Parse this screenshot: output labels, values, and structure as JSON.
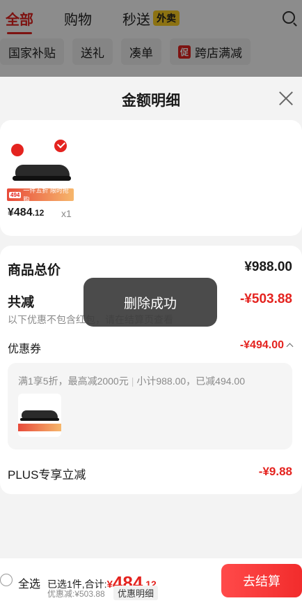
{
  "background": {
    "tabs": [
      {
        "label": "全部",
        "active": true
      },
      {
        "label": "购物"
      },
      {
        "label": "秒送",
        "badge": "外卖"
      }
    ],
    "chips": [
      {
        "label": "国家补贴"
      },
      {
        "label": "送礼"
      },
      {
        "label": "凑单"
      },
      {
        "label": "跨店满减",
        "promo": "促"
      }
    ]
  },
  "sheet": {
    "title": "金额明细",
    "product": {
      "price_symbol": "¥",
      "price_int": "484",
      "price_dec": ".12",
      "quantity": "x1",
      "promo_strip": "一件五折 限时抢购",
      "promo_tag": "494"
    },
    "detail": {
      "total_label": "商品总价",
      "total_value": "¥988.00",
      "discount_label": "共减",
      "discount_value": "-¥503.88",
      "discount_note": "以下优惠不包含红包，请在结算页查看",
      "coupon_label": "优惠券",
      "coupon_value": "-¥494.00",
      "coupon_desc_left": "满1享5折，最高减2000元",
      "coupon_desc_right": "小计988.00，已减494.00",
      "plus_label": "PLUS专享立减",
      "plus_value": "-¥9.88"
    }
  },
  "toast": "删除成功",
  "bottom": {
    "select_all": "全选",
    "summary_prefix": "已选1件,合计:",
    "total_symbol": "¥",
    "total_int": "484",
    "total_dec": ".12",
    "discount_line": "优惠减:¥503.88",
    "detail_button": "优惠明细",
    "checkout_button": "去结算"
  },
  "colors": {
    "accent": "#e4231f",
    "badge": "#ffcf22"
  }
}
